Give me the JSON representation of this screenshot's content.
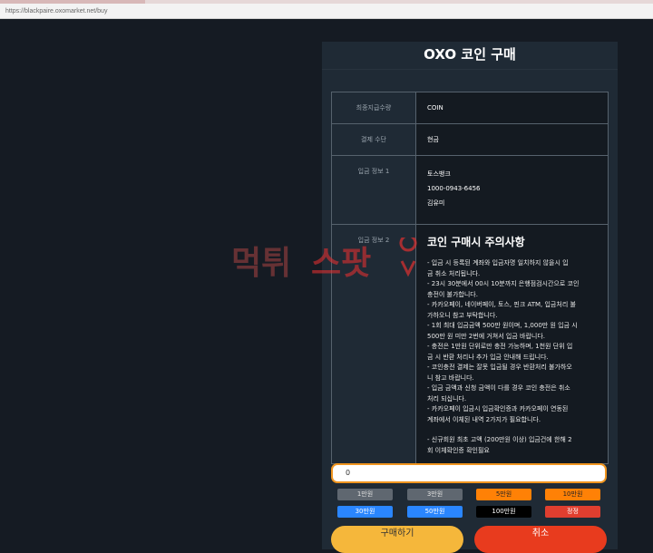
{
  "browser": {
    "url": "https://blackpaire.oxomarket.net/buy"
  },
  "page": {
    "title": "OXO 코인 구매"
  },
  "info_table": [
    {
      "label": "최종지급수량",
      "values": [
        "COIN"
      ]
    },
    {
      "label": "결제 수단",
      "values": [
        "현금"
      ]
    },
    {
      "label": "입금 정보 1",
      "values": [
        "토스뱅크",
        "1000-0943-6456",
        "김유미"
      ]
    }
  ],
  "notice": {
    "label": "입금 정보 2",
    "title": "코인 구매시 주의사항",
    "lines": [
      "- 입금 시 등록된 계좌와 입금자명 일치하지 않을시 입",
      "금 취소 처리됩니다.",
      "- 23시 30분에서 00시 10분까지 은행점검시간으로 코인",
      "충전이 불가합니다.",
      "- 카카오페이, 네이버페이, 토스, 핀크 ATM, 입금처리 불",
      "가하오니 참고 부탁합니다.",
      "- 1회 최대 입금금액 500만 원이며, 1,000만 원 입금 시",
      "500만 원 미만 2번에 거쳐서 입금 바랍니다.",
      "- 충전은 1만원 단위로만 충전 가능하며, 1천원 단위 입",
      "금 시 반환 처리나 추가 입금 안내해 드립니다.",
      "- 코인충전 결제는 잘못 입금될 경우 반환처리 불가하오",
      "니 참고 바랍니다.",
      "- 입금 금액과 신청 금액이 다를 경우 코인 충전은 취소",
      "처리 되십니다.",
      "- 카카오페이 입금시 입금확인증과 카카오페이 연동된",
      "계좌에서 이체된 내역 2가지가 필요합니다.",
      "",
      "- 신규회원 최초 고액 (200만원 이상) 입금건에 한해 2",
      "회 이체확인증 확인필요"
    ]
  },
  "amount_input": {
    "value": "0"
  },
  "amount_buttons": [
    {
      "label": "1만원",
      "color": "#5f6770"
    },
    {
      "label": "3만원",
      "color": "#5f6770"
    },
    {
      "label": "5만원",
      "color": "#ff8106"
    },
    {
      "label": "10만원",
      "color": "#ff8106"
    },
    {
      "label": "30만원",
      "color": "#2a86ff"
    },
    {
      "label": "50만원",
      "color": "#2a86ff"
    },
    {
      "label": "100만원",
      "color": "#000000"
    },
    {
      "label": "정정",
      "color": "#e03e2f"
    }
  ],
  "actions": {
    "buy": "구매하기",
    "cancel": "취소"
  },
  "watermark": {
    "text_left": "먹튀",
    "text_right": "스팟",
    "icon": "map-pin-icon"
  }
}
